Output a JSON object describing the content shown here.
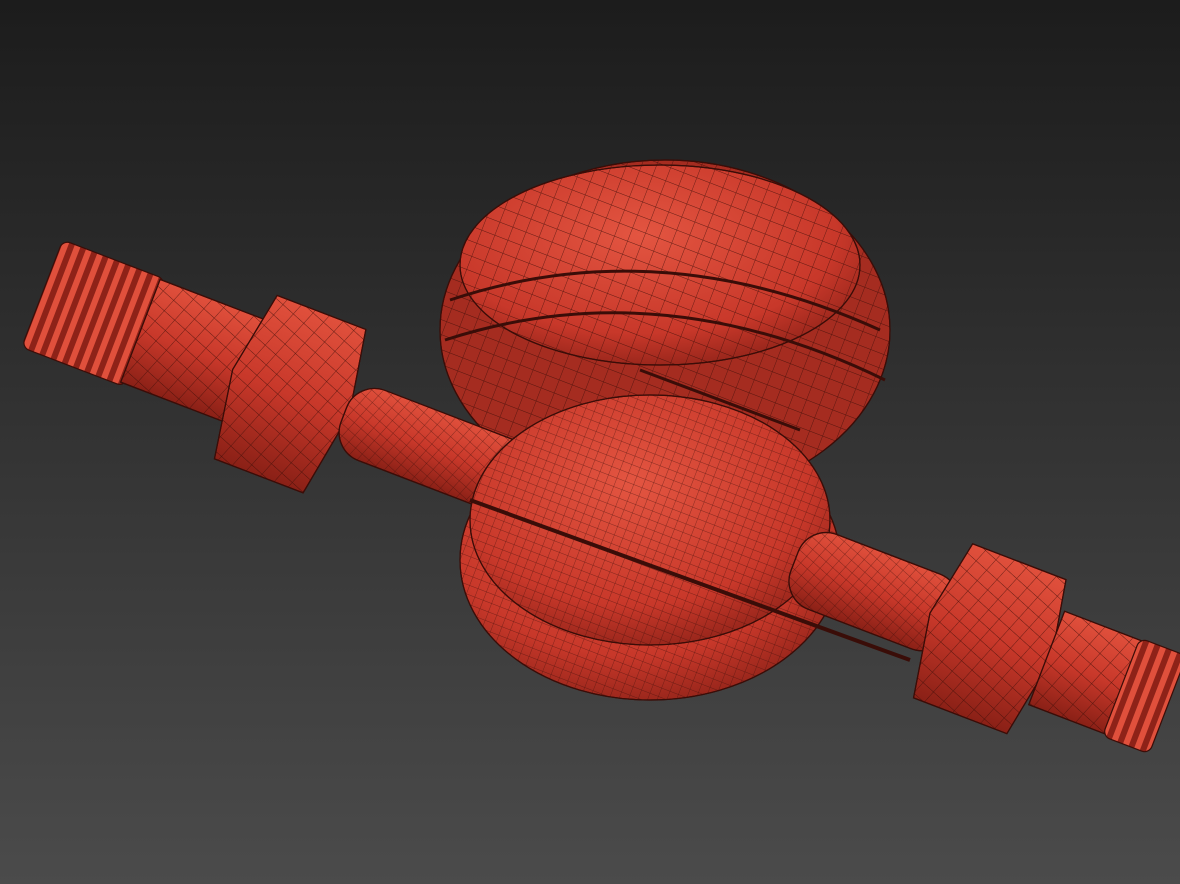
{
  "scene": {
    "subject": "water-meter-wireframe-model",
    "colors": {
      "background_top": "#1c1c1c",
      "background_bottom": "#4b4b4b",
      "model_fill": "#c8382a",
      "model_highlight": "#e0503c",
      "model_shadow": "#8e2218",
      "wire": "#3a0d08"
    }
  }
}
